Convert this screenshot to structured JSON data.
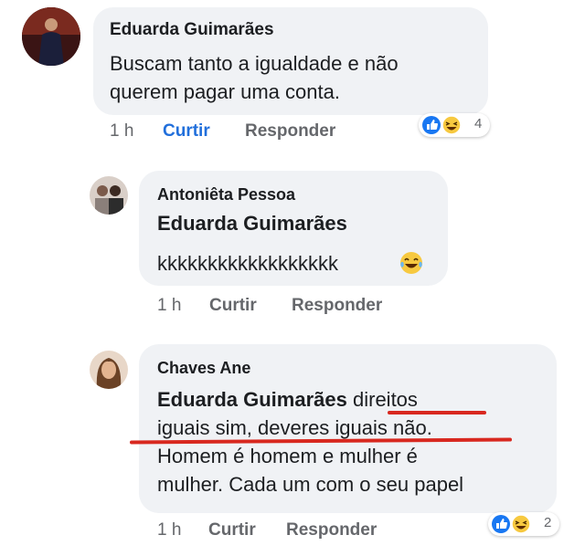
{
  "comments": [
    {
      "author": "Eduarda Guimarães",
      "text_lines": [
        "Buscam tanto a igualdade e não",
        "querem pagar uma conta."
      ],
      "time": "1 h",
      "like_label": "Curtir",
      "reply_label": "Responder",
      "reactions": {
        "icons": [
          "like-icon",
          "haha-icon"
        ],
        "count": "4"
      },
      "liked": true
    },
    {
      "author": "Antoniêta Pessoa",
      "mention": "Eduarda Guimarães",
      "text_lines": [
        "kkkkkkkkkkkkkkkkkk"
      ],
      "emoji": "laughing-tears-emoji",
      "time": "1 h",
      "like_label": "Curtir",
      "reply_label": "Responder"
    },
    {
      "author": "Chaves Ane",
      "mention": "Eduarda Guimarães",
      "line1_rest": "direitos",
      "text_lines": [
        "iguais sim, deveres iguais não.",
        "Homem é homem e mulher é",
        "mulher. Cada um com o seu papel"
      ],
      "time": "1 h",
      "like_label": "Curtir",
      "reply_label": "Responder",
      "reactions": {
        "icons": [
          "like-icon",
          "haha-icon"
        ],
        "count": "2"
      },
      "underline_color": "#d8281f"
    }
  ],
  "colors": {
    "bubble": "#f0f2f5",
    "liked": "#216fdb",
    "like_blue": "#1877f2",
    "haha_yellow": "#f7c940"
  }
}
